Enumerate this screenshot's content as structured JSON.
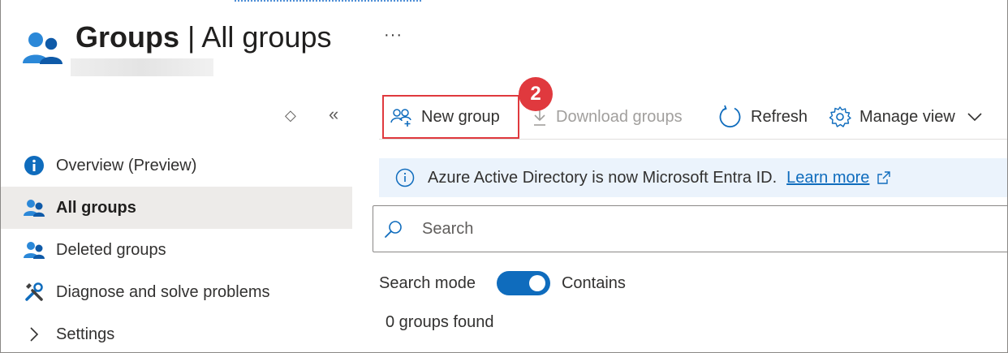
{
  "header": {
    "title_bold": "Groups",
    "title_sep": " | ",
    "title_rest": "All groups",
    "more_label": "···"
  },
  "sidebar": {
    "updown_label": "◇",
    "collapse_label": "«",
    "items": [
      {
        "label": "Overview (Preview)",
        "icon": "info-icon"
      },
      {
        "label": "All groups",
        "icon": "groups-icon",
        "selected": true
      },
      {
        "label": "Deleted groups",
        "icon": "groups-icon"
      },
      {
        "label": "Diagnose and solve problems",
        "icon": "wrench-icon"
      },
      {
        "label": "Settings",
        "icon": "chevron-right-icon"
      }
    ]
  },
  "toolbar": {
    "new_group_label": "New group",
    "download_label": "Download groups",
    "refresh_label": "Refresh",
    "manage_view_label": "Manage view",
    "step_badge": "2"
  },
  "banner": {
    "text": "Azure Active Directory is now Microsoft Entra ID.",
    "link_label": "Learn more"
  },
  "search": {
    "placeholder": "Search"
  },
  "search_mode": {
    "label": "Search mode",
    "value": "Contains",
    "enabled": true
  },
  "results": {
    "count_text": "0 groups found"
  },
  "colors": {
    "accent": "#0f6cbd",
    "highlight": "#e0393e",
    "banner_bg": "#ebf3fc",
    "selected_bg": "#edebe9"
  }
}
